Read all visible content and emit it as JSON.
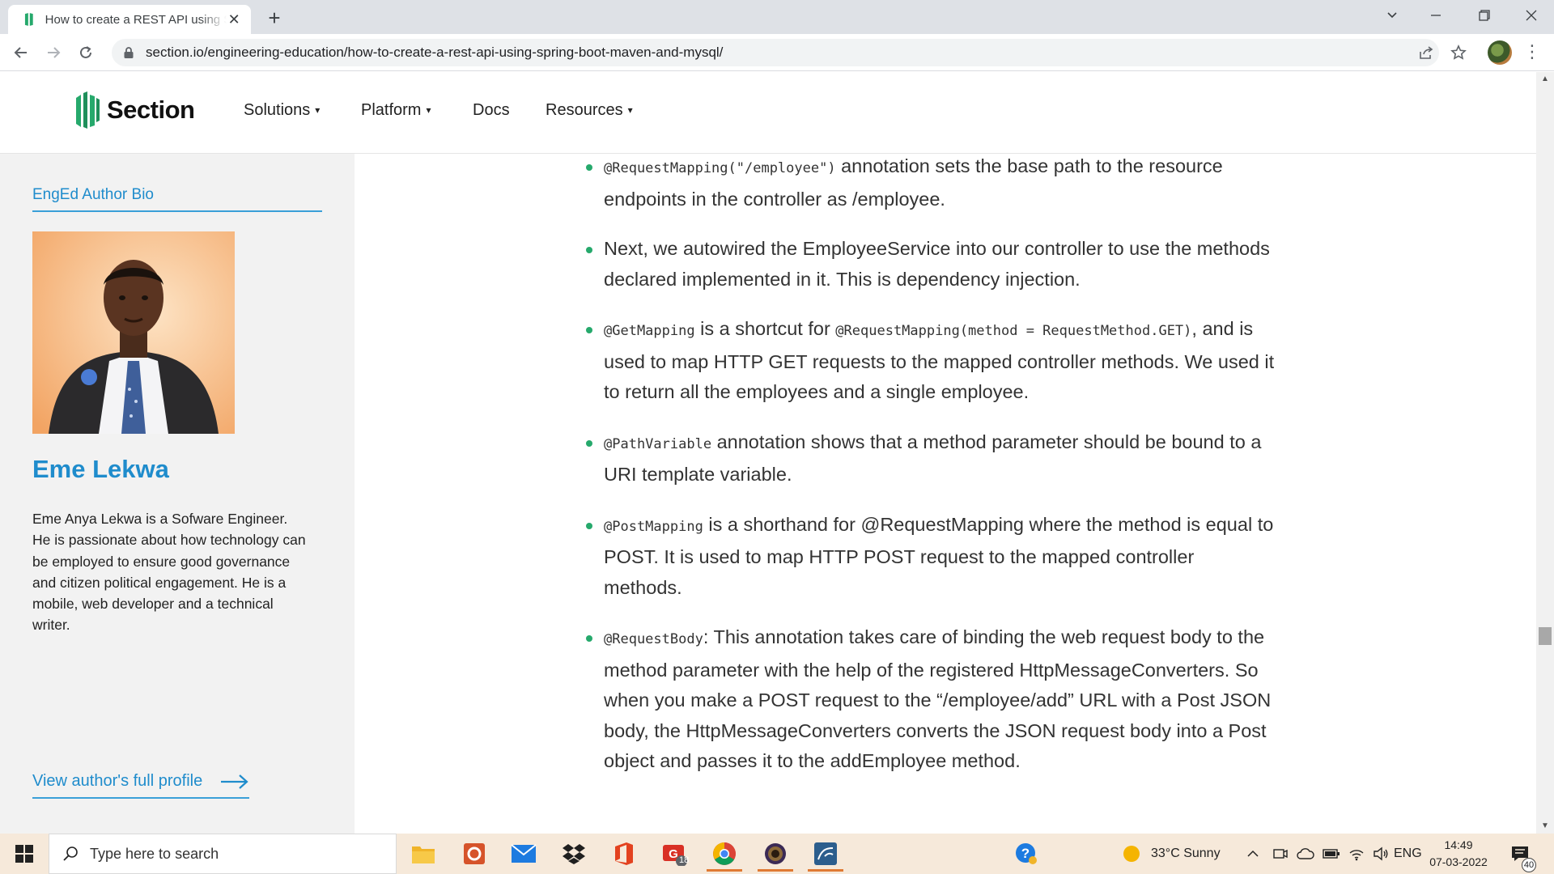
{
  "browser": {
    "tab_title": "How to create a REST API using Spring Boot, Maven, and MySQL",
    "url": "section.io/engineering-education/how-to-create-a-rest-api-using-spring-boot-maven-and-mysql/",
    "new_tab": "+",
    "tab_close": "✕",
    "menu": "⋮"
  },
  "site": {
    "brand": "Section",
    "brand_color": "#26a96c",
    "nav": [
      {
        "label": "Solutions",
        "dropdown": true
      },
      {
        "label": "Platform",
        "dropdown": true
      },
      {
        "label": "Docs",
        "dropdown": false
      },
      {
        "label": "Resources",
        "dropdown": true
      }
    ],
    "caret": "▾"
  },
  "sidebar": {
    "heading": "EngEd Author Bio",
    "author_name": "Eme Lekwa",
    "bio": "Eme Anya Lekwa is a Sofware Engineer. He is passionate about how technology can be employed to ensure good governance and citizen political engagement. He is a mobile, web developer and a technical writer.",
    "profile_link": "View author's full profile",
    "accent_color": "#1f8ccc"
  },
  "article": {
    "bullets": [
      {
        "code": "@RequestMapping(\"/employee\")",
        "text": " annotation sets the base path to the resource endpoints in the controller as /employee."
      },
      {
        "code": "",
        "text": "Next, we autowired the EmployeeService into our controller to use the methods declared implemented in it. This is dependency injection."
      },
      {
        "code": "@GetMapping",
        "text": " is a shortcut for ",
        "code2": "@RequestMapping(method = RequestMethod.GET)",
        "text2": ", and is used to map HTTP GET requests to the mapped controller methods. We used it to return all the employees and a single employee."
      },
      {
        "code": "@PathVariable",
        "text": " annotation shows that a method parameter should be bound to a URI template variable."
      },
      {
        "code": "@PostMapping",
        "text": " is a shorthand for @RequestMapping where the method is equal to POST. It is used to map HTTP POST request to the mapped controller methods."
      },
      {
        "code": "@RequestBody",
        "text": ": This annotation takes care of binding the web request body to the method parameter with the help of the registered HttpMessageConverters. So when you make a POST request to the “/employee/add” URL with a Post JSON body, the HttpMessageConverters converts the JSON request body into a Post object and passes it to the addEmployee method."
      }
    ]
  },
  "taskbar": {
    "search_placeholder": "Type here to search",
    "gmail_badge": "18",
    "weather": "33°C  Sunny",
    "language": "ENG",
    "time": "14:49",
    "date": "07-03-2022",
    "notifications": "40"
  }
}
